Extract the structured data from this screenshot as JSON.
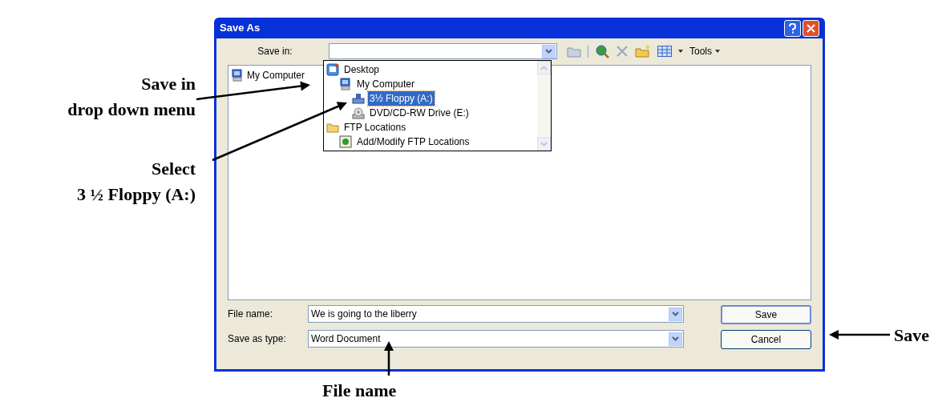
{
  "dialog": {
    "title": "Save As",
    "save_in": {
      "label": "Save in:"
    },
    "toolbar": {
      "tools_label": "Tools"
    },
    "places": [
      {
        "label": "My Computer",
        "kind": "computer"
      }
    ],
    "dropdown": {
      "items": [
        {
          "label": "Desktop",
          "kind": "desktop",
          "selected": false,
          "children": [
            {
              "label": "My Computer",
              "kind": "computer",
              "selected": false,
              "children": [
                {
                  "label": "3½ Floppy (A:)",
                  "kind": "floppy",
                  "selected": true
                },
                {
                  "label": "DVD/CD-RW Drive (E:)",
                  "kind": "cd-drive",
                  "selected": false
                }
              ]
            }
          ]
        },
        {
          "label": "FTP Locations",
          "kind": "folder",
          "selected": false,
          "children": [
            {
              "label": "Add/Modify FTP Locations",
              "kind": "ftp",
              "selected": false
            }
          ]
        }
      ]
    },
    "file_name": {
      "label": "File name:",
      "value": "We is going to the liberry"
    },
    "save_as_type": {
      "label": "Save as type:",
      "value": "Word Document"
    },
    "buttons": [
      {
        "label": "Save",
        "default": true
      },
      {
        "label": "Cancel",
        "default": false
      }
    ]
  },
  "annotations": [
    {
      "lines": [
        "Save in",
        "drop down menu"
      ]
    },
    {
      "lines": [
        "Select",
        "3 ½ Floppy (A:)"
      ]
    },
    {
      "lines": [
        "Save"
      ]
    },
    {
      "lines": [
        "File name"
      ]
    }
  ]
}
